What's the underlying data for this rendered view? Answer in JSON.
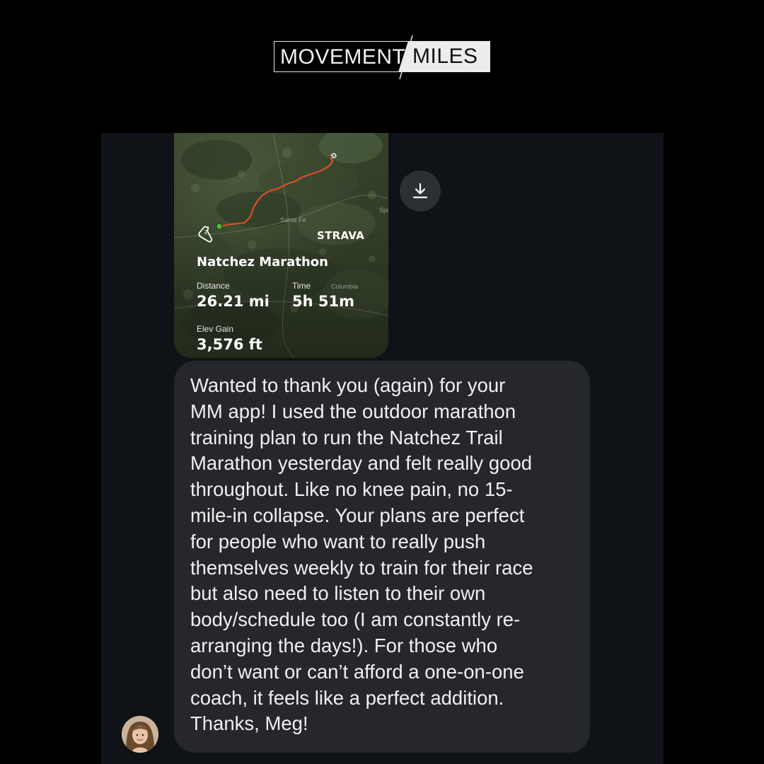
{
  "brand": {
    "left_text": "MOVEMENT",
    "right_text": "MILES"
  },
  "activity": {
    "app_logo": "STRAVA",
    "title": "Natchez Marathon",
    "distance_label": "Distance",
    "distance_value": "26.21 mi",
    "time_label": "Time",
    "time_value": "5h 51m",
    "elev_label": "Elev Gain",
    "elev_value": "3,576 ft",
    "map_labels": [
      "Santa Fe",
      "Columbia",
      "Spr"
    ]
  },
  "message": {
    "lines": [
      "Wanted to thank you (again) for your",
      "MM app! I used the outdoor marathon",
      "training plan to run the Natchez Trail",
      "Marathon yesterday and felt really good",
      "throughout. Like no knee pain, no 15-",
      "mile-in collapse. Your plans are perfect",
      "for people who want to really push",
      "themselves weekly to train for their race",
      "but also need to listen to their own",
      "body/schedule too (I am constantly re-",
      "arranging the days!). For those who",
      "don’t want or can’t afford a one-on-one",
      "coach, it feels like a perfect addition.",
      "Thanks, Meg!"
    ]
  },
  "icons": {
    "download": "download-icon",
    "shoe": "running-shoe-icon",
    "avatar": "user-avatar"
  },
  "colors": {
    "background": "#000000",
    "chat_panel": "#0f1216",
    "bubble": "#25272b",
    "route": "#e0502a",
    "download_button": "#2c2f34"
  }
}
